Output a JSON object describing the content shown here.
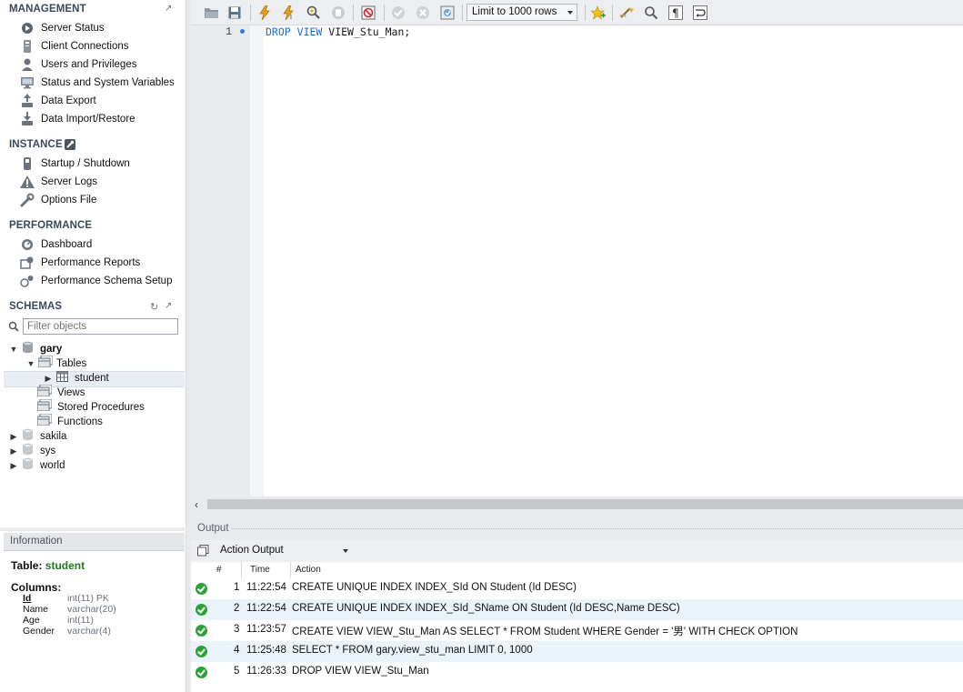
{
  "sidebar": {
    "management": {
      "title": "MANAGEMENT",
      "items": [
        {
          "label": "Server Status",
          "icon": "server-status-icon"
        },
        {
          "label": "Client Connections",
          "icon": "client-connections-icon"
        },
        {
          "label": "Users and Privileges",
          "icon": "user-icon"
        },
        {
          "label": "Status and System Variables",
          "icon": "monitor-icon"
        },
        {
          "label": "Data Export",
          "icon": "export-icon"
        },
        {
          "label": "Data Import/Restore",
          "icon": "import-icon"
        }
      ]
    },
    "instance": {
      "title": "INSTANCE",
      "items": [
        {
          "label": "Startup / Shutdown",
          "icon": "power-icon"
        },
        {
          "label": "Server Logs",
          "icon": "warning-icon"
        },
        {
          "label": "Options File",
          "icon": "wrench-icon"
        }
      ]
    },
    "performance": {
      "title": "PERFORMANCE",
      "items": [
        {
          "label": "Dashboard",
          "icon": "dashboard-icon"
        },
        {
          "label": "Performance Reports",
          "icon": "reports-icon"
        },
        {
          "label": "Performance Schema Setup",
          "icon": "schema-setup-icon"
        }
      ]
    },
    "schemas": {
      "title": "SCHEMAS",
      "filter_placeholder": "Filter objects",
      "tree": {
        "gary": "gary",
        "tables": "Tables",
        "student": "student",
        "views": "Views",
        "stored_procedures": "Stored Procedures",
        "functions": "Functions",
        "sakila": "sakila",
        "sys": "sys",
        "world": "world"
      }
    }
  },
  "info": {
    "header": "Information",
    "table_label": "Table:",
    "table_name": "student",
    "columns_label": "Columns:",
    "columns": [
      {
        "name": "Id",
        "type": "int(11) PK"
      },
      {
        "name": "Name",
        "type": "varchar(20)"
      },
      {
        "name": "Age",
        "type": "int(11)"
      },
      {
        "name": "Gender",
        "type": "varchar(4)"
      }
    ]
  },
  "toolbar": {
    "limit_label": "Limit to 1000 rows"
  },
  "editor": {
    "line_number": "1",
    "keyword1": "DROP",
    "keyword2": "VIEW",
    "identifier": "VIEW_Stu_Man;"
  },
  "output": {
    "title": "Output",
    "selector": "Action Output",
    "headers": {
      "num": "#",
      "time": "Time",
      "action": "Action"
    },
    "rows": [
      {
        "num": "1",
        "time": "11:22:54",
        "action": "CREATE UNIQUE INDEX INDEX_SId ON Student (Id DESC)"
      },
      {
        "num": "2",
        "time": "11:22:54",
        "action": "CREATE UNIQUE INDEX INDEX_SId_SName ON Student (Id DESC,Name DESC)"
      },
      {
        "num": "3",
        "time": "11:23:57",
        "action": "CREATE VIEW VIEW_Stu_Man AS SELECT * FROM Student WHERE Gender = '男' WITH CHECK OPTION"
      },
      {
        "num": "4",
        "time": "11:25:48",
        "action": "SELECT * FROM gary.view_stu_man LIMIT 0, 1000"
      },
      {
        "num": "5",
        "time": "11:26:33",
        "action": "DROP VIEW VIEW_Stu_Man"
      }
    ]
  },
  "colors": {
    "keyword": "#1a6fd1",
    "success": "#2aa235",
    "table_name": "#1f7a1f",
    "row_highlight": "#eaf2fa"
  }
}
